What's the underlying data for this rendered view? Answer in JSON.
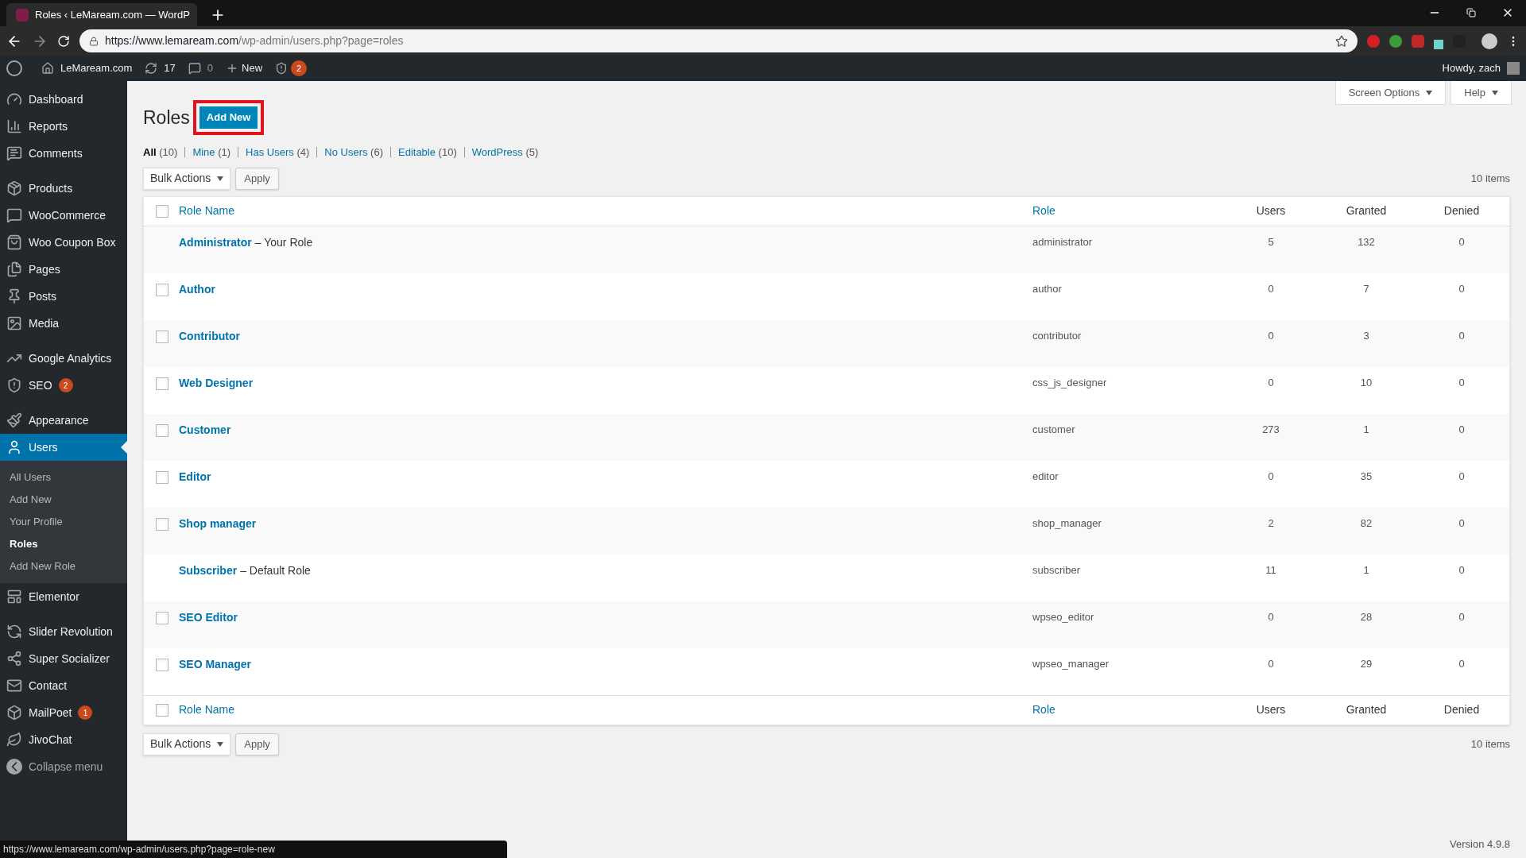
{
  "browser": {
    "tab_title": "Roles ‹ LeMaream.com — WordP",
    "url_host": "https://www.lemaream.com",
    "url_path": "/wp-admin/users.php?page=roles"
  },
  "admin_bar": {
    "site": "LeMaream.com",
    "updates": "17",
    "comments": "0",
    "new": "New",
    "seo_badge": "2",
    "howdy": "Howdy, zach"
  },
  "sidebar": {
    "items": [
      {
        "label": "Dashboard",
        "selected": false
      },
      {
        "label": "Reports",
        "selected": false
      },
      {
        "label": "Comments",
        "selected": false
      },
      {
        "label": "Products",
        "selected": false
      },
      {
        "label": "WooCommerce",
        "selected": false
      },
      {
        "label": "Woo Coupon Box",
        "selected": false
      },
      {
        "label": "Pages",
        "selected": false
      },
      {
        "label": "Posts",
        "selected": false
      },
      {
        "label": "Media",
        "selected": false
      },
      {
        "label": "Google Analytics",
        "selected": false
      },
      {
        "label": "SEO",
        "selected": false,
        "badge": "2"
      },
      {
        "label": "Appearance",
        "selected": false
      },
      {
        "label": "Users",
        "selected": true,
        "children": [
          {
            "label": "All Users",
            "selected": false
          },
          {
            "label": "Add New",
            "selected": false
          },
          {
            "label": "Your Profile",
            "selected": false
          },
          {
            "label": "Roles",
            "selected": true
          },
          {
            "label": "Add New Role",
            "selected": false
          }
        ]
      },
      {
        "label": "Elementor",
        "selected": false
      },
      {
        "label": "Slider Revolution",
        "selected": false
      },
      {
        "label": "Super Socializer",
        "selected": false
      },
      {
        "label": "Contact",
        "selected": false
      },
      {
        "label": "MailPoet",
        "selected": false,
        "badge": "1"
      },
      {
        "label": "JivoChat",
        "selected": false
      },
      {
        "label": "Collapse menu",
        "selected": false
      }
    ]
  },
  "screen_options": [
    "Screen Options",
    "Help"
  ],
  "page": {
    "title": "Roles",
    "add_button": "Add New",
    "add_highlighted": true
  },
  "filters": [
    {
      "label": "All",
      "count": "(10)",
      "selected": true
    },
    {
      "label": "Mine",
      "count": "(1)",
      "selected": false
    },
    {
      "label": "Has Users",
      "count": "(4)",
      "selected": false
    },
    {
      "label": "No Users",
      "count": "(6)",
      "selected": false
    },
    {
      "label": "Editable",
      "count": "(10)",
      "selected": false
    },
    {
      "label": "WordPress",
      "count": "(5)",
      "selected": false
    }
  ],
  "bulk_actions": {
    "select": "Bulk Actions",
    "apply": "Apply",
    "items_count": "10 items"
  },
  "table": {
    "columns": [
      "Role Name",
      "Role",
      "Users",
      "Granted",
      "Denied"
    ],
    "header_checked": false,
    "rows": [
      {
        "name": "Administrator",
        "note": "– Your Role",
        "role": "administrator",
        "users": "5",
        "granted": "132",
        "denied": "0"
      },
      {
        "name": "Author",
        "role": "author",
        "users": "0",
        "granted": "7",
        "denied": "0",
        "checked": false
      },
      {
        "name": "Contributor",
        "role": "contributor",
        "users": "0",
        "granted": "3",
        "denied": "0",
        "checked": false
      },
      {
        "name": "Web Designer",
        "role": "css_js_designer",
        "users": "0",
        "granted": "10",
        "denied": "0",
        "checked": false
      },
      {
        "name": "Customer",
        "role": "customer",
        "users": "273",
        "granted": "1",
        "denied": "0",
        "checked": false
      },
      {
        "name": "Editor",
        "role": "editor",
        "users": "0",
        "granted": "35",
        "denied": "0",
        "checked": false
      },
      {
        "name": "Shop manager",
        "role": "shop_manager",
        "users": "2",
        "granted": "82",
        "denied": "0",
        "checked": false
      },
      {
        "name": "Subscriber",
        "note": "– Default Role",
        "role": "subscriber",
        "users": "11",
        "granted": "1",
        "denied": "0"
      },
      {
        "name": "SEO Editor",
        "role": "wpseo_editor",
        "users": "0",
        "granted": "28",
        "denied": "0",
        "checked": false
      },
      {
        "name": "SEO Manager",
        "role": "wpseo_manager",
        "users": "0",
        "granted": "29",
        "denied": "0",
        "checked": false
      }
    ],
    "footer_columns": [
      "Role Name",
      "Role",
      "Users",
      "Granted",
      "Denied"
    ],
    "footer_checked": false
  },
  "bottom_bulk_actions": {
    "select": "Bulk Actions",
    "apply": "Apply",
    "items_count": "10 items"
  },
  "version": "Version 4.9.8",
  "status_url": "https://www.lemaream.com/wp-admin/users.php?page=role-new"
}
